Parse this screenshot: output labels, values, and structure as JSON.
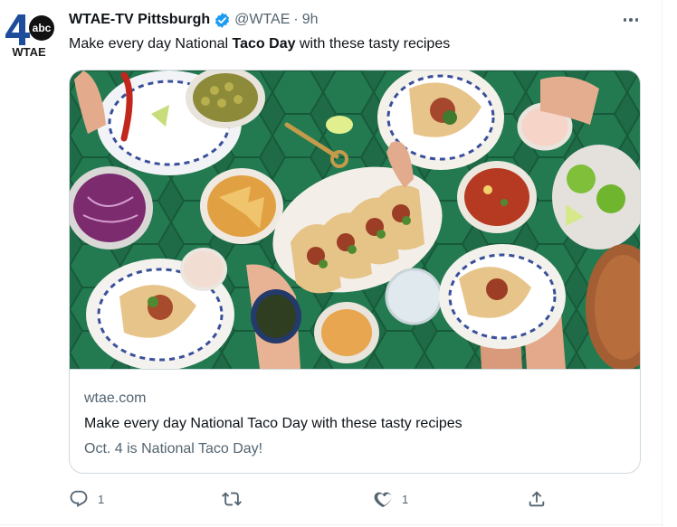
{
  "author": {
    "display_name": "WTAE-TV Pittsburgh",
    "handle": "@WTAE",
    "separator": "·",
    "time": "9h",
    "verified_icon": "verified-badge-icon",
    "avatar_logo": "WTAE channel 4 abc logo",
    "avatar_wordmark": "WTAE",
    "avatar_abc": "abc"
  },
  "tweet": {
    "text_before": "Make every day National ",
    "text_bold": "Taco Day",
    "text_after": " with these tasty recipes"
  },
  "card": {
    "image": "overhead photo of tacos, salsa, olives, chips and lime on green tiles",
    "domain": "wtae.com",
    "title": "Make every day National Taco Day with these tasty recipes",
    "description": "Oct. 4 is National Taco Day!"
  },
  "actions": {
    "reply": {
      "icon": "reply-icon",
      "count": "1"
    },
    "retweet": {
      "icon": "retweet-icon",
      "count": ""
    },
    "like": {
      "icon": "heart-icon",
      "count": "1"
    },
    "share": {
      "icon": "share-icon"
    }
  },
  "colors": {
    "text_primary": "#0f1419",
    "text_secondary": "#536471",
    "verified_blue": "#1d9bf0",
    "border": "#cfd9de",
    "tile_green": "#1f6b47",
    "abc_blue": "#1e4e9b"
  }
}
